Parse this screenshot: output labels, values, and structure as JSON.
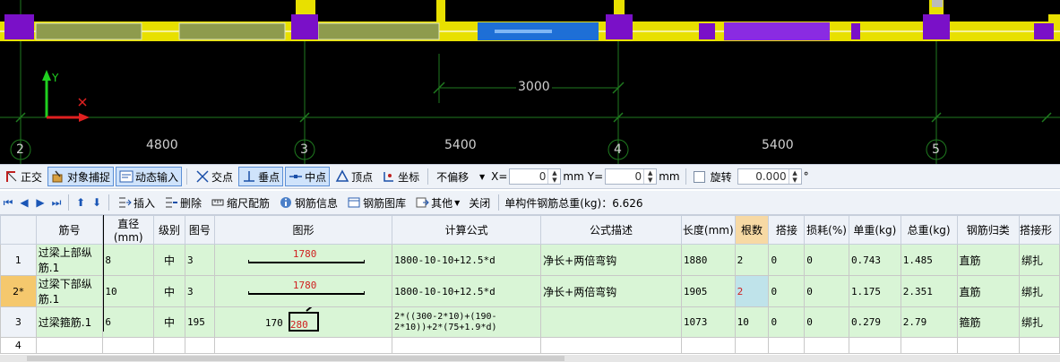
{
  "cad": {
    "axis_labels": [
      "2",
      "3",
      "4",
      "5"
    ],
    "dimensions": [
      "4800",
      "5400",
      "5400"
    ],
    "aux_dimension": "3000",
    "ucs_y_label": "Y"
  },
  "toolbar1": {
    "ortho": "正交",
    "snap": "对象捕捉",
    "dynamic_input": "动态输入",
    "intersection": "交点",
    "perpendicular": "垂点",
    "midpoint": "中点",
    "vertex": "顶点",
    "coordinate": "坐标",
    "offset_mode": "不偏移",
    "x_label": "X=",
    "x_value": "0",
    "x_unit": "mm",
    "y_label": "Y=",
    "y_value": "0",
    "y_unit": "mm",
    "rotate_label": "旋转",
    "rotate_value": "0.000",
    "degree": "°"
  },
  "toolbar2": {
    "insert": "插入",
    "delete": "删除",
    "scale_rebar": "缩尺配筋",
    "rebar_info": "钢筋信息",
    "rebar_library": "钢筋图库",
    "other": "其他",
    "close": "关闭",
    "total_weight_label": "单构件钢筋总重(kg)：6.626"
  },
  "table": {
    "headers": [
      "",
      "筋号",
      "直径(mm)",
      "级别",
      "图号",
      "图形",
      "计算公式",
      "公式描述",
      "长度(mm)",
      "根数",
      "搭接",
      "损耗(%)",
      "单重(kg)",
      "总重(kg)",
      "钢筋归类",
      "搭接形"
    ],
    "rows": [
      {
        "rownum": "1",
        "name": "过梁上部纵筋.1",
        "dia": "8",
        "grade": "中",
        "fig": "3",
        "shape_label": "1780",
        "formula": "1800-10-10+12.5*d",
        "desc": "净长+两倍弯钩",
        "length": "1880",
        "count": "2",
        "lap": "0",
        "loss": "0",
        "unit_w": "0.743",
        "total_w": "1.485",
        "category": "直筋",
        "lap_type": "绑扎"
      },
      {
        "rownum": "2*",
        "name": "过梁下部纵筋.1",
        "dia": "10",
        "grade": "中",
        "fig": "3",
        "shape_label": "1780",
        "formula": "1800-10-10+12.5*d",
        "desc": "净长+两倍弯钩",
        "length": "1905",
        "count": "2",
        "lap": "0",
        "loss": "0",
        "unit_w": "1.175",
        "total_w": "2.351",
        "category": "直筋",
        "lap_type": "绑扎"
      },
      {
        "rownum": "3",
        "name": "过梁箍筋.1",
        "dia": "6",
        "grade": "中",
        "fig": "195",
        "shape_left": "170",
        "shape_label": "280",
        "formula": "2*((300-2*10)+(190-2*10))+2*(75+1.9*d)",
        "desc": "",
        "length": "1073",
        "count": "10",
        "lap": "0",
        "loss": "0",
        "unit_w": "0.279",
        "total_w": "2.79",
        "category": "箍筋",
        "lap_type": "绑扎"
      },
      {
        "rownum": "4"
      }
    ]
  }
}
